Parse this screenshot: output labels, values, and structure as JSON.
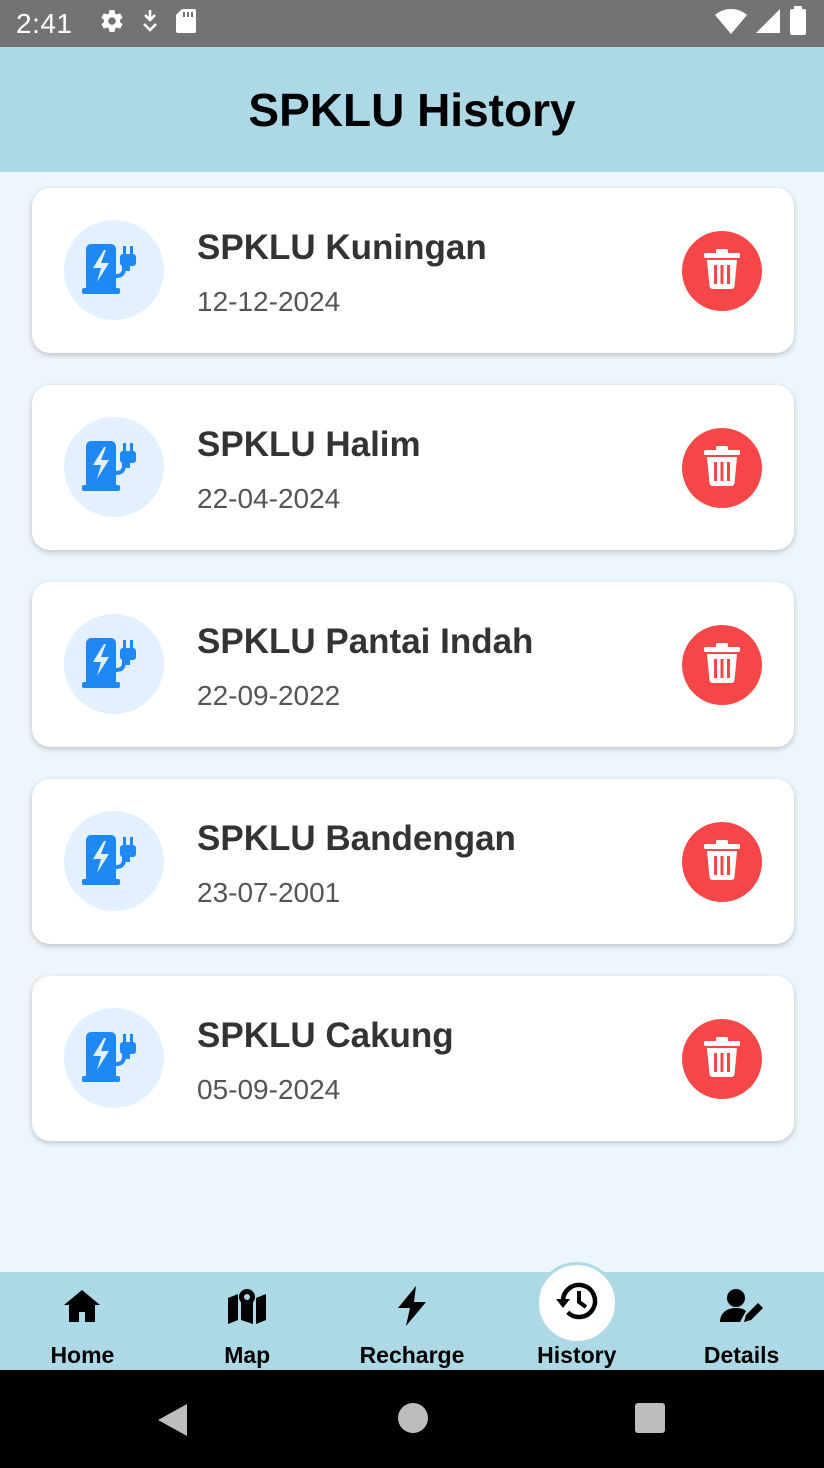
{
  "status_bar": {
    "time": "2:41",
    "left_icons": [
      "gear-icon",
      "download-icon",
      "sd-card-icon"
    ],
    "right_icons": [
      "wifi-icon",
      "signal-icon",
      "battery-icon"
    ]
  },
  "header": {
    "title": "SPKLU History"
  },
  "colors": {
    "header_bg": "#add8e6",
    "page_bg": "#eef6fd",
    "charger_blue": "#1e88f5",
    "delete_red": "#f54748"
  },
  "history": [
    {
      "name": "SPKLU Kuningan",
      "date": "12-12-2024"
    },
    {
      "name": "SPKLU Halim",
      "date": "22-04-2024"
    },
    {
      "name": "SPKLU Pantai Indah",
      "date": "22-09-2022"
    },
    {
      "name": "SPKLU Bandengan",
      "date": "23-07-2001"
    },
    {
      "name": "SPKLU Cakung",
      "date": "05-09-2024"
    }
  ],
  "bottom_nav": {
    "items": [
      {
        "label": "Home",
        "icon": "home-icon"
      },
      {
        "label": "Map",
        "icon": "map-icon"
      },
      {
        "label": "Recharge",
        "icon": "bolt-icon"
      },
      {
        "label": "History",
        "icon": "history-icon",
        "active": true
      },
      {
        "label": "Details",
        "icon": "user-edit-icon"
      }
    ]
  },
  "system_nav": [
    "back-icon",
    "home-circle-icon",
    "recents-icon"
  ]
}
